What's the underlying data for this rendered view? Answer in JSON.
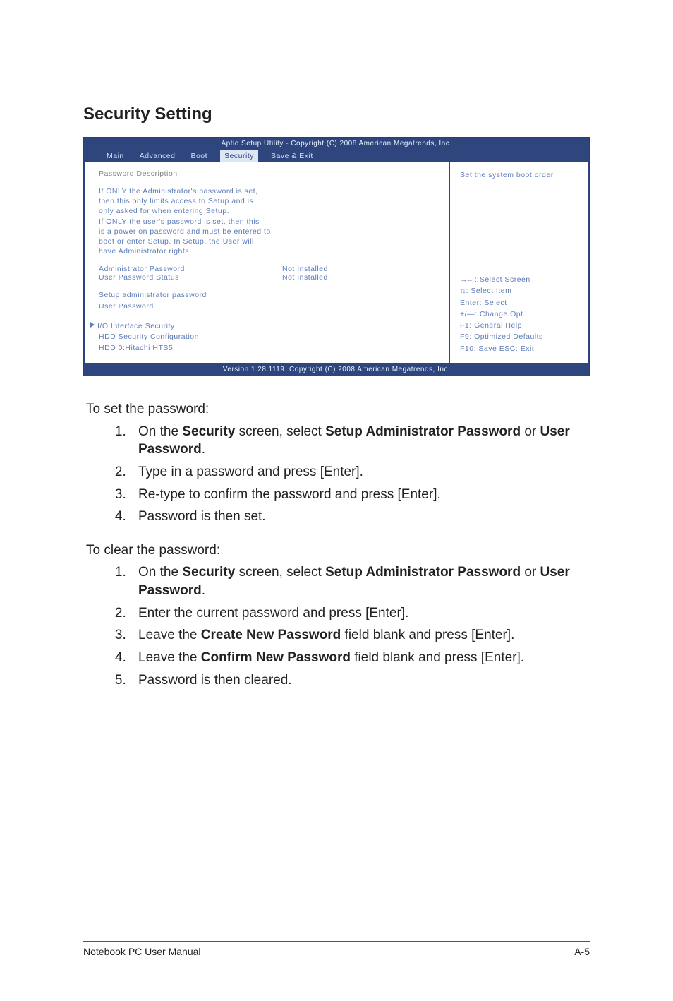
{
  "section_title": "Security Setting",
  "bios": {
    "title": "Aptio Setup Utility - Copyright (C) 2008 American Megatrends, Inc.",
    "tabs": [
      "Main",
      "Advanced",
      "Boot",
      "Security",
      "Save & Exit"
    ],
    "active_tab": "Security",
    "heading": "Password Description",
    "desc_lines": [
      "If ONLY the Administrator's password is set,",
      "then this only limits access to Setup and is",
      "only asked for when entering Setup.",
      "If ONLY the user's password is set, then this",
      "is a power on password and must be entered to",
      "boot or enter Setup. In Setup, the User will",
      "have Administrator rights."
    ],
    "rows": [
      {
        "k": "Administrator Password",
        "v": "Not Installed"
      },
      {
        "k": "User Password Status",
        "v": "Not Installed"
      }
    ],
    "actions": [
      "Setup administrator password",
      "User Password"
    ],
    "submenus": [
      "I/O Interface Security",
      "HDD Security Configuration:",
      "HDD 0:Hitachi HTS5"
    ],
    "right_hint": "Set the system boot order.",
    "keys": [
      {
        "sym": "arrows",
        "txt": "Select Screen"
      },
      {
        "sym": "updown",
        "txt": "Select Item"
      },
      {
        "sym": "",
        "txt": "Enter: Select"
      },
      {
        "sym": "",
        "txt": "+/—:  Change Opt."
      },
      {
        "sym": "",
        "txt": "F1:    General Help"
      },
      {
        "sym": "",
        "txt": "F9:    Optimized Defaults"
      },
      {
        "sym": "",
        "txt": "F10:  Save    ESC:  Exit"
      }
    ],
    "footer": "Version 1.28.1119. Copyright (C) 2008 American Megatrends, Inc."
  },
  "doc": {
    "set_lead": "To set the password:",
    "set_steps_pre": [
      "On the ",
      "Security",
      " screen, select ",
      "Setup Administrator Password",
      " or ",
      "User Password",
      "."
    ],
    "set_steps": [
      "Type in a password and press [Enter].",
      "Re-type to confirm the password and press [Enter].",
      "Password is then set."
    ],
    "clear_lead": "To clear the password:",
    "clear_step1": [
      "On the ",
      "Security",
      " screen, select ",
      "Setup Administrator Password",
      " or ",
      "User Password",
      "."
    ],
    "clear_steps_rest": [
      "Enter the current password and press [Enter].",
      [
        "Leave the ",
        "Create New Password",
        " field blank and press [Enter]."
      ],
      [
        "Leave the ",
        "Confirm New Password",
        " field blank and press [Enter]."
      ],
      "Password is then cleared."
    ]
  },
  "footer": {
    "left": "Notebook PC User Manual",
    "right": "A-5"
  }
}
